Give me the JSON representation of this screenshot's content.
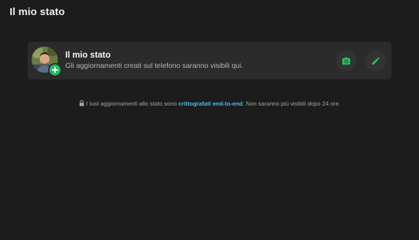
{
  "page": {
    "title": "Il mio stato"
  },
  "status_card": {
    "title": "Il mio stato",
    "subtitle": "Gli aggiornamenti creati sul telefono saranno visibili qui.",
    "avatar_icon": "profile-photo",
    "badge_icon": "plus-icon",
    "actions": [
      {
        "icon": "camera-icon"
      },
      {
        "icon": "pencil-icon"
      }
    ]
  },
  "encryption_note": {
    "icon": "lock-icon",
    "prefix": "I tuoi aggiornamenti allo stato sono",
    "link_text": "crittografati end-to-end",
    "suffix": ". Non saranno più visibili dopo 24 ore."
  },
  "colors": {
    "background": "#1c1c1c",
    "card": "#2b2b2b",
    "accent_green": "#21c063",
    "link_blue": "#53bdeb"
  }
}
